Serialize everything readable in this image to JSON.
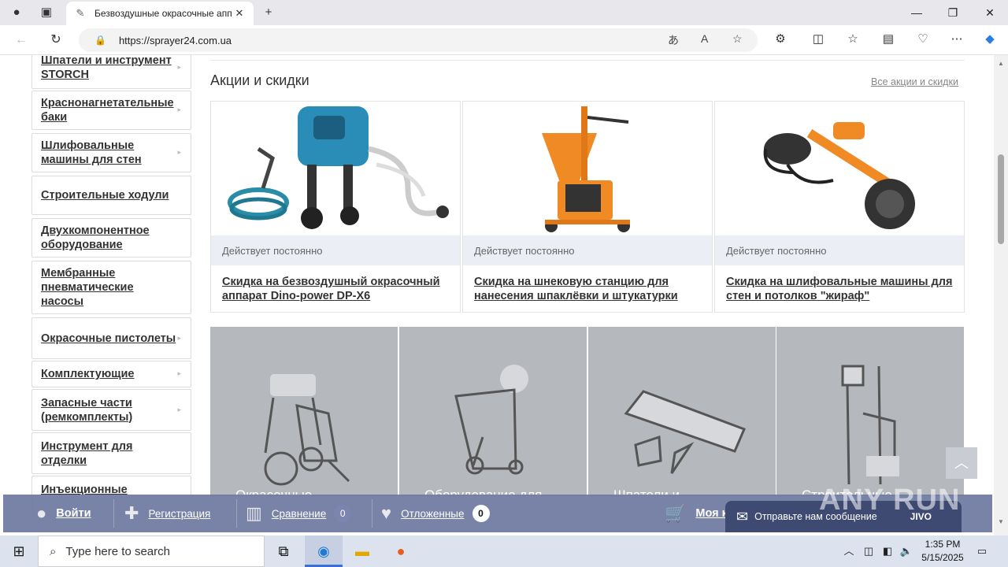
{
  "browser": {
    "tab_title": "Безвоздушные окрасочные апп",
    "url": "https://sprayer24.com.ua"
  },
  "sidebar": {
    "items": [
      {
        "label": "Шпатели и инструмент STORCH",
        "has_submenu": true
      },
      {
        "label": "Краснонагнетательные баки",
        "has_submenu": true
      },
      {
        "label": "Шлифовальные машины для стен",
        "has_submenu": true
      },
      {
        "label": "Строительные ходули",
        "has_submenu": false
      },
      {
        "label": "Двухкомпонентное оборудование",
        "has_submenu": false
      },
      {
        "label": "Мембранные пневматические насосы",
        "has_submenu": false
      },
      {
        "label": "Окрасочные пистолеты",
        "has_submenu": true
      },
      {
        "label": "Комплектующие",
        "has_submenu": true
      },
      {
        "label": "Запасные части (ремкомплекты)",
        "has_submenu": true
      },
      {
        "label": "Инструмент для отделки",
        "has_submenu": false
      },
      {
        "label": "Инъекционные",
        "has_submenu": false
      }
    ]
  },
  "promos": {
    "section_title": "Акции и скидки",
    "all_link": "Все акции и скидки",
    "items": [
      {
        "meta": "Действует постоянно",
        "title": "Скидка на безвоздушный окрасочный аппарат Dino-power DP-X6"
      },
      {
        "meta": "Действует постоянно",
        "title": "Скидка на шнековую станцию для нанесения шпаклёвки и штукатурки"
      },
      {
        "meta": "Действует постоянно",
        "title": "Скидка на шлифовальные машины для стен и потолков \"жираф\""
      }
    ]
  },
  "categories": [
    {
      "caption": "Окрасочные"
    },
    {
      "caption": "Оборудование для"
    },
    {
      "caption": "Шпатели и"
    },
    {
      "caption": "Строительные"
    }
  ],
  "bottom_bar": {
    "login": "Войти",
    "register": "Регистрация",
    "compare": "Сравнение",
    "compare_count": "0",
    "deferred": "Отложенные",
    "deferred_count": "0",
    "cart": "Моя к"
  },
  "chat": {
    "label": "Отправьте нам сообщение",
    "brand": "JIVO"
  },
  "watermark": "ANY RUN",
  "taskbar": {
    "search_placeholder": "Type here to search",
    "time": "1:35 PM",
    "date": "5/15/2025"
  }
}
